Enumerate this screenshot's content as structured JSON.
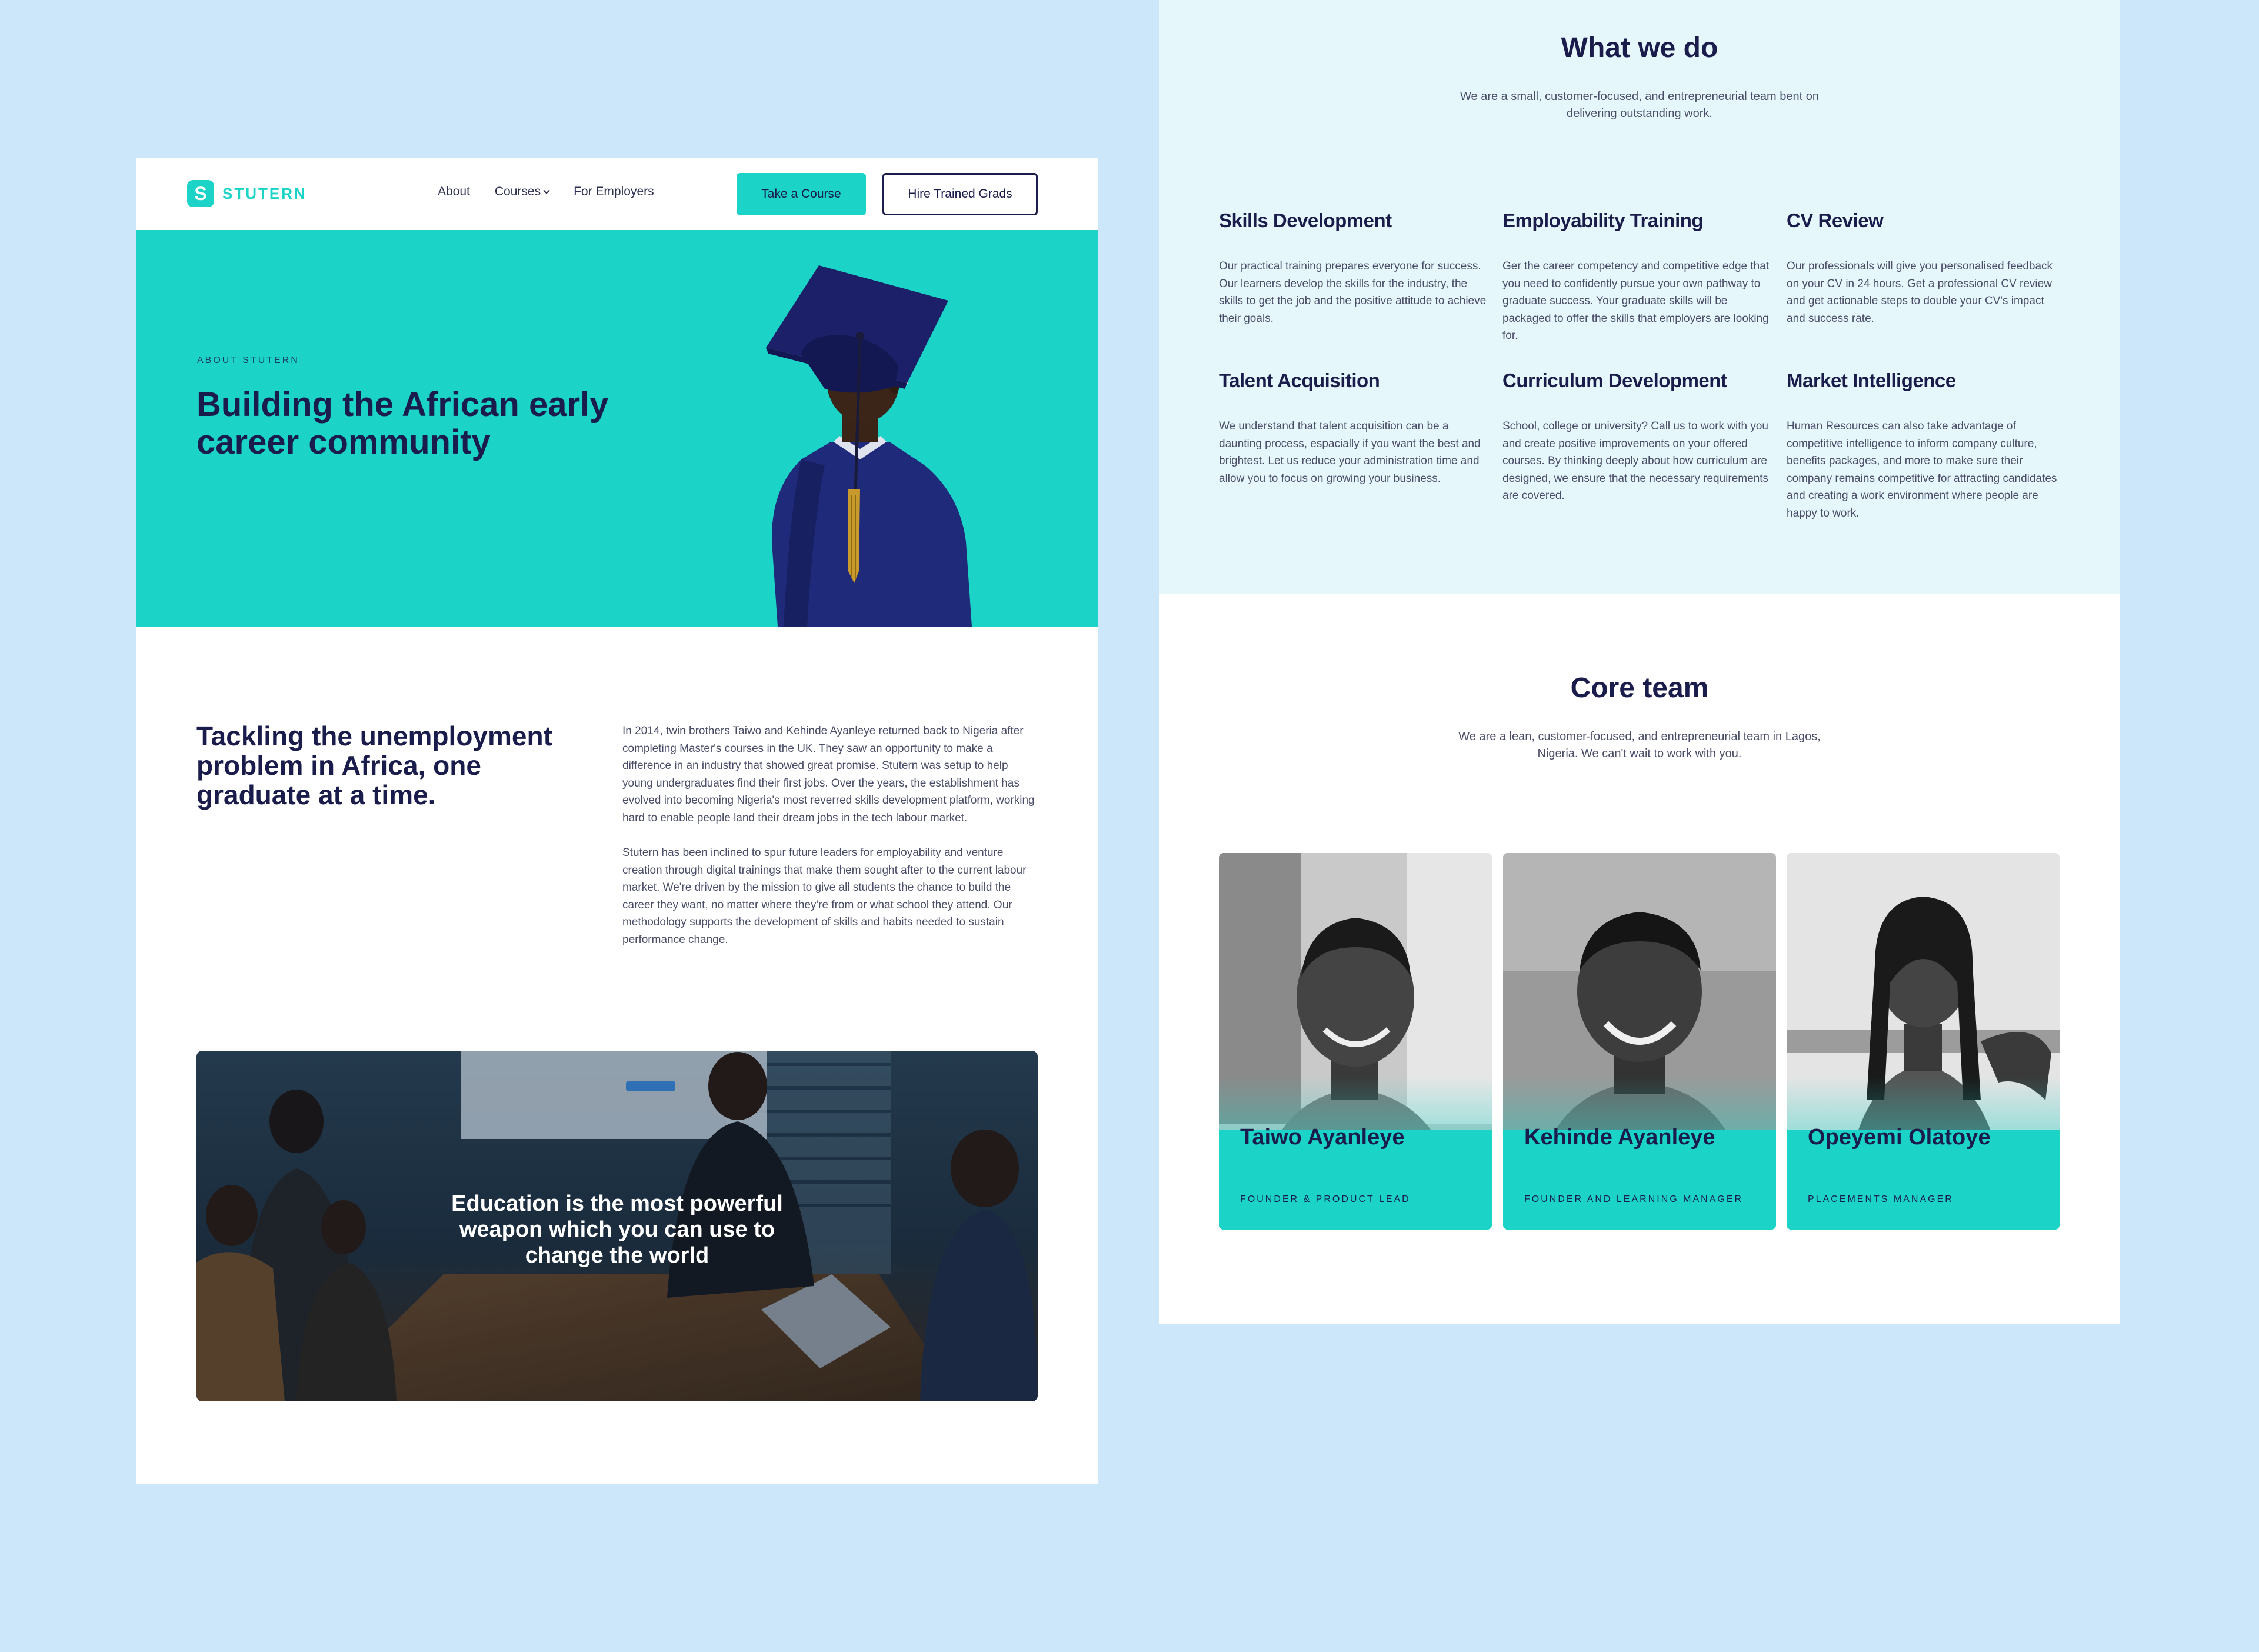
{
  "left": {
    "nav": {
      "logo_letter": "S",
      "logo_text": "STUTERN",
      "links": [
        "About",
        "Courses",
        "For Employers"
      ],
      "cta_primary": "Take a Course",
      "cta_secondary": "Hire Trained Grads"
    },
    "hero": {
      "eyebrow": "ABOUT STUTERN",
      "title": "Building the African early career community"
    },
    "mission": {
      "title": "Tackling the unemployment problem in Africa, one graduate at a time.",
      "paragraphs": [
        "In 2014, twin brothers Taiwo and Kehinde Ayanleye returned back to Nigeria after completing Master's courses in the UK. They saw an opportunity to make a difference in an industry that showed great promise. Stutern was setup to help young undergraduates find their first jobs. Over the years, the establishment has evolved into becoming Nigeria's most reverred skills development platform, working hard to enable people land their dream jobs in the tech labour market.",
        "Stutern has been inclined to spur future leaders for employability and venture creation through digital trainings that make them sought after to the current labour market. We're driven by the mission to give all students the chance to build the career they want, no matter where they're from or what school they attend. Our methodology supports the development of skills and habits needed to sustain performance change."
      ]
    },
    "quote": "Education is the most powerful weapon which you can use to change the world"
  },
  "right": {
    "services": {
      "title": "What we do",
      "subtitle": "We are a small, customer-focused, and entrepreneurial team bent on delivering outstanding work.",
      "items": [
        {
          "title": "Skills Development",
          "desc": "Our practical training prepares everyone for success. Our learners develop the skills for the industry, the skills to get the job and the positive attitude to achieve their goals."
        },
        {
          "title": "Employability Training",
          "desc": "Ger the career competency and competitive edge that you need to confidently pursue your own pathway to graduate success. Your graduate skills will be packaged to offer the skills that employers are looking for."
        },
        {
          "title": "CV Review",
          "desc": "Our professionals will give you personalised feedback on your CV in 24 hours. Get a professional CV review and get actionable steps to double your CV's impact and success rate."
        },
        {
          "title": "Talent Acquisition",
          "desc": "We understand that talent acquisition can be a daunting process, espacially if you want the best and brightest. Let us reduce your administration time and allow you to focus on growing your business."
        },
        {
          "title": "Curriculum Development",
          "desc": "School, college or university? Call us to work with you and create positive improvements on your offered courses. By thinking deeply about how curriculum are designed, we ensure that the necessary requirements are covered."
        },
        {
          "title": "Market Intelligence",
          "desc": "Human Resources can also take advantage of competitive intelligence to inform company culture, benefits packages, and more to make sure their company remains competitive for attracting candidates and creating a work environment where people are happy to work."
        }
      ]
    },
    "team": {
      "title": "Core team",
      "subtitle": "We are a lean, customer-focused, and entrepreneurial team in Lagos, Nigeria. We can't wait to work with you.",
      "members": [
        {
          "name": "Taiwo Ayanleye",
          "role": "FOUNDER & PRODUCT LEAD"
        },
        {
          "name": "Kehinde Ayanleye",
          "role": "FOUNDER AND LEARNING MANAGER"
        },
        {
          "name": "Opeyemi Olatoye",
          "role": "PLACEMENTS MANAGER"
        }
      ]
    }
  },
  "colors": {
    "background": "#cde7fa",
    "accent": "#1bd3c6",
    "navy": "#1a1c4b",
    "services_bg": "#e6f7fb"
  }
}
